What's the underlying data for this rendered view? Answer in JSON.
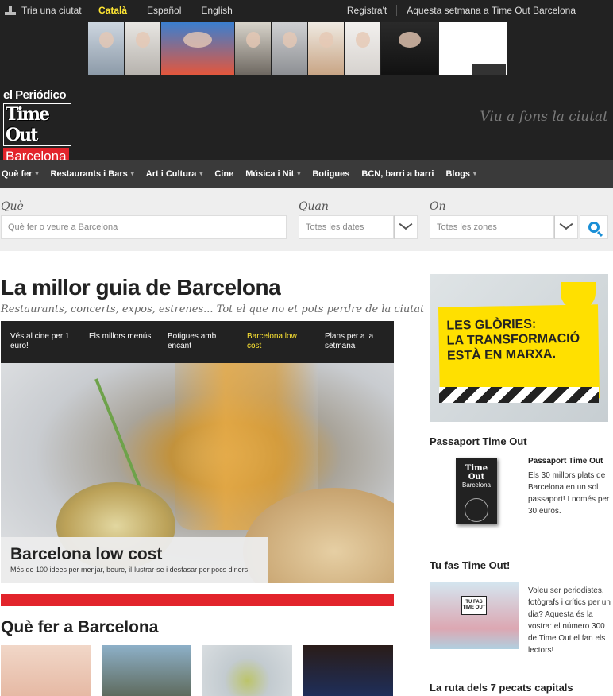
{
  "topbar": {
    "city_label": "Tria una ciutat",
    "languages": [
      "Català",
      "Español",
      "English"
    ],
    "active_language": "Català",
    "register": "Registra't",
    "this_week": "Aquesta setmana a Time Out Barcelona"
  },
  "header": {
    "logo_periodico": "el Periódico",
    "logo_timeout": "Time Out",
    "logo_city": "Barcelona",
    "tagline": "Viu a fons la ciutat"
  },
  "nav": {
    "items": [
      {
        "label": "Què fer",
        "dropdown": true
      },
      {
        "label": "Restaurants i Bars",
        "dropdown": true
      },
      {
        "label": "Art i Cultura",
        "dropdown": true
      },
      {
        "label": "Cine",
        "dropdown": false
      },
      {
        "label": "Música i Nit",
        "dropdown": true
      },
      {
        "label": "Botigues",
        "dropdown": false
      },
      {
        "label": "BCN, barri a barri",
        "dropdown": false
      },
      {
        "label": "Blogs",
        "dropdown": true
      }
    ]
  },
  "search": {
    "what_label": "Què",
    "what_placeholder": "Què fer o veure a Barcelona",
    "when_label": "Quan",
    "when_value": "Totes les dates",
    "where_label": "On",
    "where_value": "Totes les zones"
  },
  "main": {
    "title": "La millor guia de Barcelona",
    "subtitle": "Restaurants, concerts, expos, estrenes... Tot el que no et pots perdre de la ciutat",
    "tabs": [
      {
        "label": "Vés al cine per 1 euro!"
      },
      {
        "label": "Els millors menús"
      },
      {
        "label": "Botigues amb encant"
      },
      {
        "label": "Barcelona low cost"
      },
      {
        "label": "Plans per a la setmana"
      }
    ],
    "active_tab": 3,
    "hero_title": "Barcelona low cost",
    "hero_desc": "Més de 100 idees per menjar, beure, il·lustrar-se i desfasar per pocs diners",
    "section_title": "Què fer a Barcelona"
  },
  "sidebar": {
    "ad_line1": "LES GLÒRIES:",
    "ad_line2": "LA TRANSFORMACIÓ",
    "ad_line3": "ESTÀ EN MARXA.",
    "passport_heading": "Passaport Time Out",
    "passport_title": "Passaport Time Out",
    "passport_text": "Els 30 millors plats de Barcelona en un sol passaport! I només per 30 euros.",
    "passport_cover_title": "Time Out",
    "passport_cover_city": "Barcelona",
    "tufas_heading": "Tu fas Time Out!",
    "tufas_sign": "TU FAS TIME OUT",
    "tufas_text": "Voleu ser periodistes, fotògrafs i crítics per un dia? Aquesta és la vostra: el número 300 de Time Out el fan els lectors!",
    "ruta_heading": "La ruta dels 7 pecats capitals"
  },
  "colors": {
    "brand_red": "#e2242b",
    "accent_yellow": "#ffe633",
    "search_blue": "#1a8fd6"
  }
}
